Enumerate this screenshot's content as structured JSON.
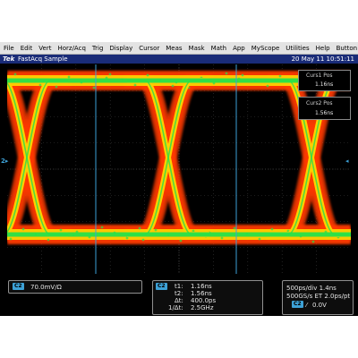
{
  "menubar": {
    "items": [
      "File",
      "Edit",
      "Vert",
      "Horz/Acq",
      "Trig",
      "Display",
      "Cursor",
      "Meas",
      "Mask",
      "Math",
      "App",
      "MyScope",
      "Utilities",
      "Help",
      "Button"
    ]
  },
  "status": {
    "logo": "Tek",
    "mode": "FastAcq Sample",
    "datetime": "20 May 11 10:51:11"
  },
  "cursor1": {
    "title": "Curs1 Pos",
    "value": "1.16ns"
  },
  "cursor2": {
    "title": "Curs2 Pos",
    "value": "1.56ns"
  },
  "channel": {
    "badge": "C2",
    "scale": "70.0mV/Ω",
    "marker": "2"
  },
  "cursor_readout": {
    "badge": "C2",
    "t1_label": "t1:",
    "t1": "1.16ns",
    "t2_label": "t2:",
    "t2": "1.56ns",
    "dt_label": "Δt:",
    "dt": "400.0ps",
    "inv_label": "1/Δt:",
    "inv": "2.5GHz"
  },
  "timebase": {
    "line1": "500ps/div 1.4ns",
    "line2": "500GS/s ET 2.0ps/pt",
    "trig_badge": "C2",
    "trig_level": "0.0V"
  },
  "colors": {
    "screen": "#000000",
    "menu": "#e3e3e3",
    "status": "#1a2c78",
    "channel": "#3da1d6",
    "trace_hot": "#ff3a00",
    "trace_mid": "#ffd000",
    "trace_core": "#27e04a"
  }
}
